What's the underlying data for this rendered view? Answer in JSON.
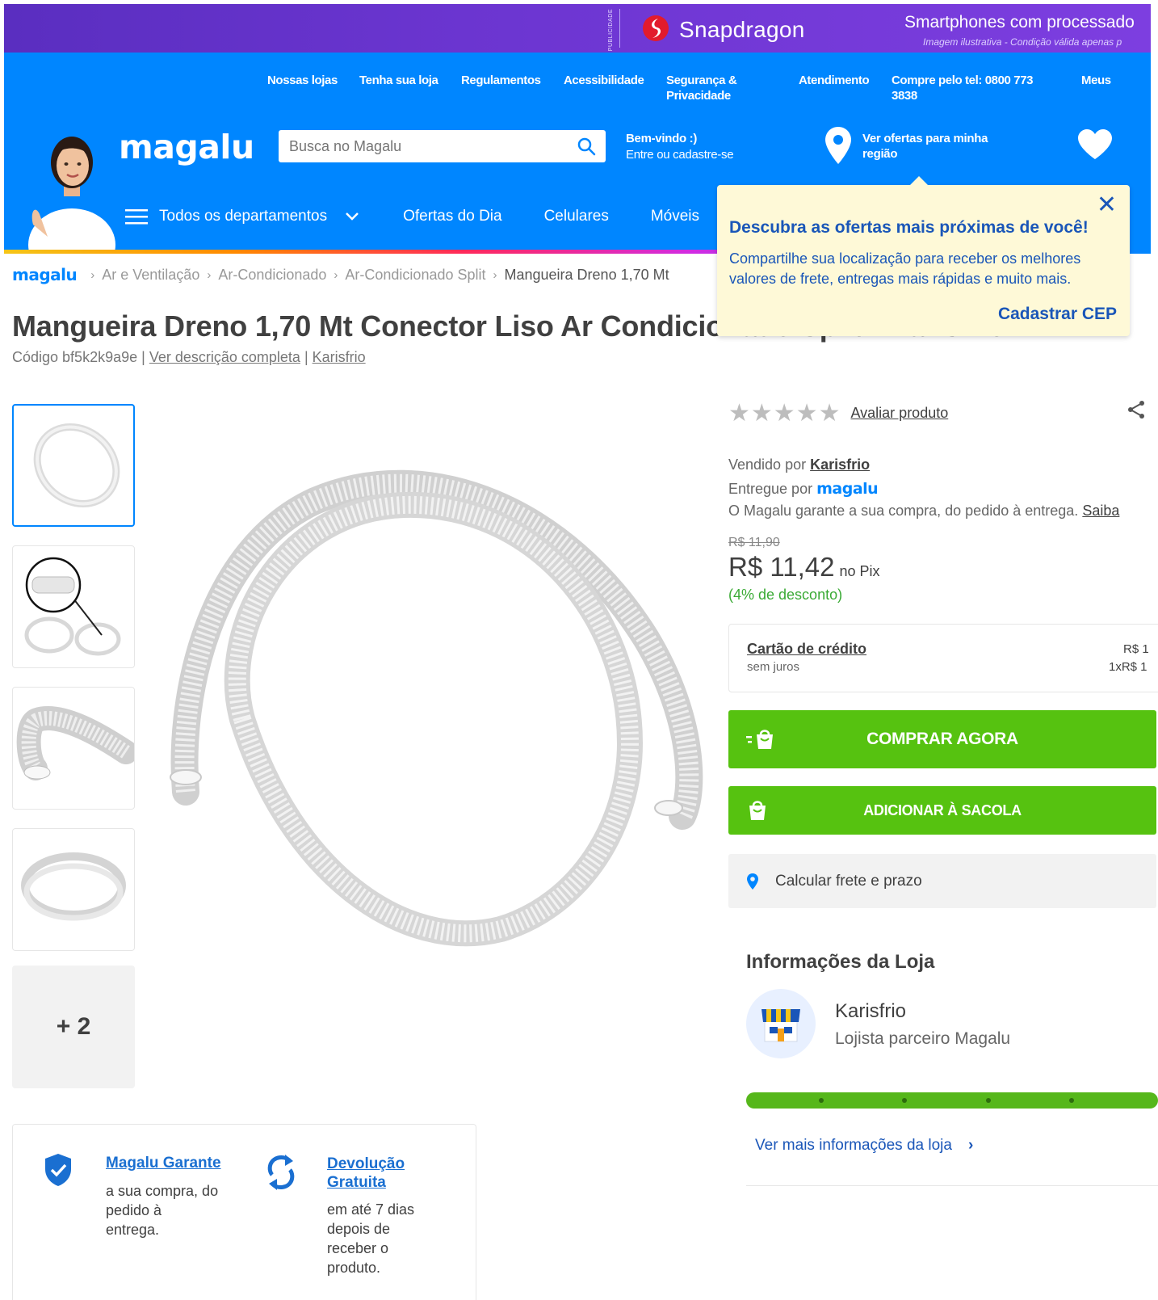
{
  "ad": {
    "publicidade": "PUBLICIDADE",
    "brand": "Snapdragon",
    "headline": "Smartphones com processado",
    "disclaimer": "Imagem ilustrativa - Condição válida apenas p"
  },
  "header": {
    "top_links": [
      {
        "label": "Nossas lojas"
      },
      {
        "label": "Tenha sua loja"
      },
      {
        "label": "Regulamentos"
      },
      {
        "label": "Acessibilidade"
      },
      {
        "label": "Segurança & Privacidade"
      },
      {
        "label": "Atendimento"
      },
      {
        "label": "Compre pelo tel: 0800 773 3838"
      },
      {
        "label": "Meus"
      }
    ],
    "logo": "magalu",
    "search_placeholder": "Busca no Magalu",
    "welcome_line1": "Bem-vindo :)",
    "welcome_line2": "Entre ou cadastre-se",
    "location_text": "Ver ofertas para minha região",
    "nav": {
      "departments": "Todos os departamentos",
      "items": [
        "Ofertas do Dia",
        "Celulares",
        "Móveis"
      ]
    }
  },
  "popup": {
    "title": "Descubra as ofertas mais próximas de você!",
    "body": "Compartilhe sua localização para receber os melhores valores de frete, entregas mais rápidas e muito mais.",
    "cta": "Cadastrar CEP",
    "close": "✕"
  },
  "breadcrumb": {
    "home": "magalu",
    "items": [
      "Ar e Ventilação",
      "Ar-Condicionado",
      "Ar-Condicionado Split",
      "Mangueira Dreno 1,70 Mt"
    ]
  },
  "product": {
    "title": "Mangueira Dreno 1,70 Mt Conector Liso Ar Condicionado Split - Karisfrio",
    "code": "Código bf5k2k9a9e",
    "see_description": "Ver descrição completa",
    "brand_link": "Karisfrio",
    "more_images": "+ 2",
    "rating_stars": "★★★★★",
    "rate_link": "Avaliar produto",
    "sold_by_label": "Vendido por",
    "sold_by": "Karisfrio",
    "delivered_by_label": "Entregue por",
    "delivered_by": "magalu",
    "guarantee_line": "O Magalu garante a sua compra, do pedido à entrega.",
    "guarantee_link": "Saiba",
    "old_price": "R$ 11,90",
    "price": "R$ 11,42",
    "price_suffix": "no Pix",
    "discount": "(4% de desconto)"
  },
  "credit": {
    "title": "Cartão de crédito",
    "subtitle": "sem juros",
    "right1": "R$ 1",
    "right2": "1xR$ 1"
  },
  "buttons": {
    "buy_now": "COMPRAR AGORA",
    "add_to_bag": "ADICIONAR À SACOLA"
  },
  "freight": {
    "label": "Calcular frete e prazo"
  },
  "store": {
    "heading": "Informações da Loja",
    "name": "Karisfrio",
    "subtitle": "Lojista parceiro Magalu",
    "more": "Ver mais informações da loja"
  },
  "guarantee_box": {
    "g1_title": "Magalu Garante",
    "g1_desc": "a sua compra, do pedido à entrega.",
    "g2_title": "Devolução Gratuita",
    "g2_desc": "em até 7 dias depois de receber o produto."
  },
  "colors": {
    "brand_blue": "#0086ff",
    "buy_green": "#56c210",
    "popup_bg": "#fef9d7",
    "ad_purple": "#6b35d0"
  }
}
